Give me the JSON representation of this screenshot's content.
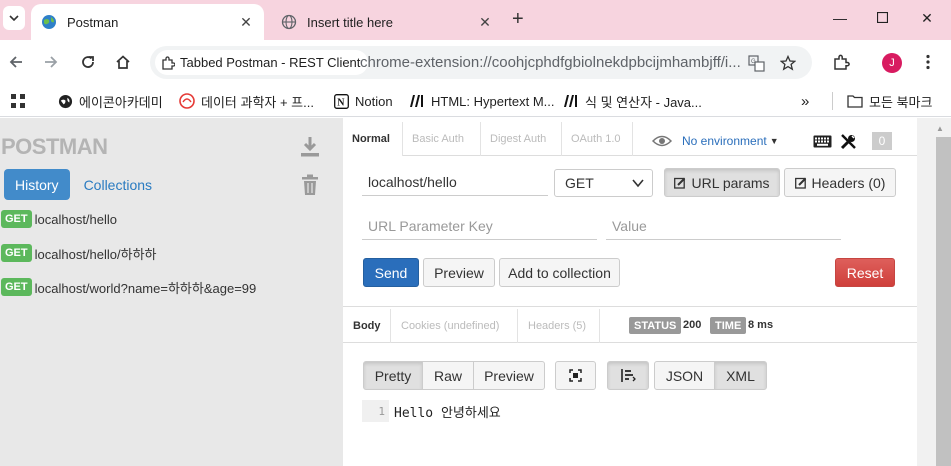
{
  "browser": {
    "tabs": [
      {
        "title": "Postman",
        "active": true
      },
      {
        "title": "Insert title here",
        "active": false
      }
    ],
    "site_chip": "Tabbed Postman - REST Client",
    "url": "chrome-extension://coohjcphdfgbiolnekdpbcijmhambjff/i...",
    "profile_initial": "J",
    "profile_color": "#d81b60",
    "bookmarks": [
      {
        "label": "에이콘아카데미",
        "icon": "globe-icon"
      },
      {
        "label": "데이터 과학자 + 프...",
        "icon": "data-scientist-icon"
      },
      {
        "label": "Notion",
        "icon": "notion-icon"
      },
      {
        "label": "HTML: Hypertext M...",
        "icon": "mdn-icon"
      },
      {
        "label": "식 및 연산자 - Java...",
        "icon": "mdn-icon"
      }
    ],
    "all_bookmarks": "모든 북마크"
  },
  "postman": {
    "logo": "POSTMAN",
    "sidebar_tabs": {
      "history": "History",
      "collections": "Collections"
    },
    "history": [
      {
        "method": "GET",
        "url": "localhost/hello"
      },
      {
        "method": "GET",
        "url": "localhost/hello/하하하"
      },
      {
        "method": "GET",
        "url": "localhost/world?name=하하하&age=99"
      }
    ],
    "auth_tabs": [
      "Normal",
      "Basic Auth",
      "Digest Auth",
      "OAuth 1.0"
    ],
    "environment": "No environment",
    "env_count": "0",
    "request": {
      "url": "localhost/hello",
      "method": "GET",
      "url_params_label": "URL params",
      "headers_label": "Headers (0)",
      "param_key_placeholder": "URL Parameter Key",
      "param_value_placeholder": "Value"
    },
    "actions": {
      "send": "Send",
      "preview": "Preview",
      "add_to_collection": "Add to collection",
      "reset": "Reset"
    },
    "response": {
      "tabs": [
        "Body",
        "Cookies (undefined)",
        "Headers (5)"
      ],
      "status_label": "STATUS",
      "status_value": "200",
      "time_label": "TIME",
      "time_value": "8 ms",
      "view_modes": [
        "Pretty",
        "Raw",
        "Preview"
      ],
      "formats": [
        "JSON",
        "XML"
      ],
      "lines": [
        {
          "num": "1",
          "text": "Hello 안녕하세요"
        }
      ]
    },
    "colors": {
      "primary": "#428bca",
      "send": "#2a6ebb",
      "reset": "#d9534f",
      "get_badge": "#5cb85c"
    }
  }
}
